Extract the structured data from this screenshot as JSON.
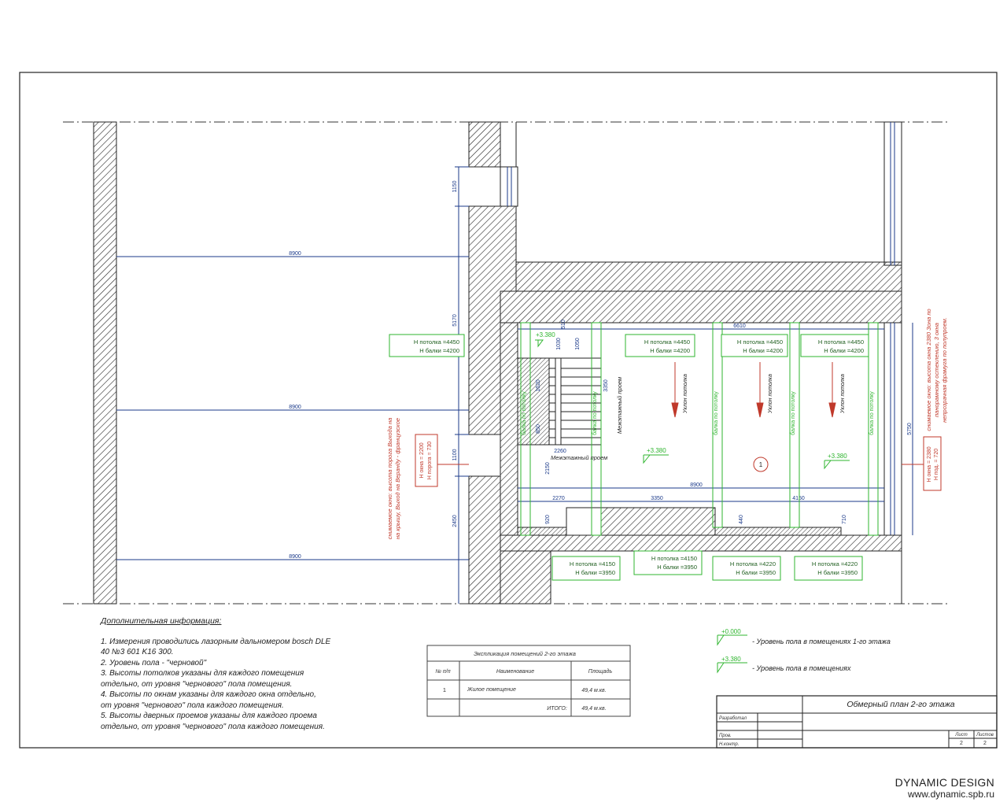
{
  "notes": {
    "title": "Дополнительная информация:",
    "lines": [
      "1. Измерения проводились лазорным дальномером bosch DLE",
      "40 №3 601 K16 300.",
      "2. Уровень пола - \"черновой\"",
      "3. Высоты потолков указаны для каждого помещения",
      "отдельно, от уровня \"чернового\" пола помещения.",
      "4. Высоты по окнам указаны для каждого окна отдельно,",
      "от уровня \"чернового\" пола каждого помещения.",
      "5. Высоты дверных проемов указаны для каждого проема",
      "отдельно, от уровня \"чернового\" пола каждого помещения."
    ]
  },
  "explication": {
    "title": "Экспликация помещений 2-го этажа",
    "headers": [
      "№ п/п",
      "Наименование",
      "Площадь"
    ],
    "row": [
      "1",
      "Жилое помещение",
      "49,4 м.кв."
    ],
    "total_label": "ИТОГО:",
    "total_value": "49,4 м.кв."
  },
  "legend": {
    "items": [
      {
        "mark": "+0.000",
        "text": "- Уровень пола в помещениях 1-го этажа"
      },
      {
        "mark": "+3.380",
        "text": "- Уровень пола в помещениях"
      }
    ]
  },
  "stamp": {
    "title": "Обмерный план 2-го этажа",
    "roles": [
      "Разработал",
      "Пров.",
      "Н.контр."
    ],
    "sheet_label": "Лист",
    "sheets_label": "Листов",
    "sheet": "2",
    "sheets": "2"
  },
  "brand": {
    "name": "DYNAMIC DESIGN",
    "url": "www.dynamic.spb.ru"
  },
  "plan": {
    "room_number": "1",
    "level_marks": [
      "+3.380",
      "+3.380",
      "+3.380",
      "+3.380"
    ],
    "dimensions": {
      "left_spans": [
        "8900",
        "8900",
        "8900"
      ],
      "vertical_left": [
        "1150",
        "5170",
        "1100",
        "2450"
      ],
      "room_width_top": "6610",
      "room_width_bottom": "8900",
      "room_height_right": "5750",
      "bottom_segments": [
        "2270",
        "3350",
        "4150"
      ],
      "stair": [
        "2260",
        "3350",
        "1050",
        "920",
        "1620",
        "1030",
        "510",
        "850",
        "440",
        "710",
        "2150"
      ]
    },
    "ceiling_tags": [
      {
        "h_ceiling": "Н потолка =4450",
        "h_beam": "Н балки =4200"
      },
      {
        "h_ceiling": "Н потолка =4450",
        "h_beam": "Н балки =4200"
      },
      {
        "h_ceiling": "Н потолка =4450",
        "h_beam": "Н балки =4200"
      },
      {
        "h_ceiling": "Н потолка =4450",
        "h_beam": "Н балки =4200"
      },
      {
        "h_ceiling": "Н потолка =4150",
        "h_beam": "Н балки =3950"
      },
      {
        "h_ceiling": "Н потолка =4150",
        "h_beam": "Н балки =3950"
      },
      {
        "h_ceiling": "Н потолка =4220",
        "h_beam": "Н балки =3950"
      },
      {
        "h_ceiling": "Н потолка =4220",
        "h_beam": "Н балки =3950"
      }
    ],
    "slope_labels": [
      "Уклон потолка",
      "Уклон потолка",
      "Уклон потолка"
    ],
    "beam_labels": [
      "балка по потолку",
      "балка по потолку",
      "балка по потолку",
      "балка по потолку",
      "балка по потолку"
    ],
    "openings": [
      "Межэтажный проем",
      "Межэтажный проем"
    ],
    "door_left": {
      "h1": "Н окна = 2200",
      "h2": "Н порога = 730",
      "note1": "снимаемое окно: высота порога Выхода на",
      "note2": "на крышу, Выход на Веранду - французское"
    },
    "window_right": {
      "h1": "Н окна = 2380",
      "h2": "Н под. = 720",
      "note1": "снимаемое окно: высота окна 2380 Зона по",
      "note2": "панорамному остеклению, 3 окна",
      "note3": "непрозрачная фрамуга по полупроем."
    }
  }
}
